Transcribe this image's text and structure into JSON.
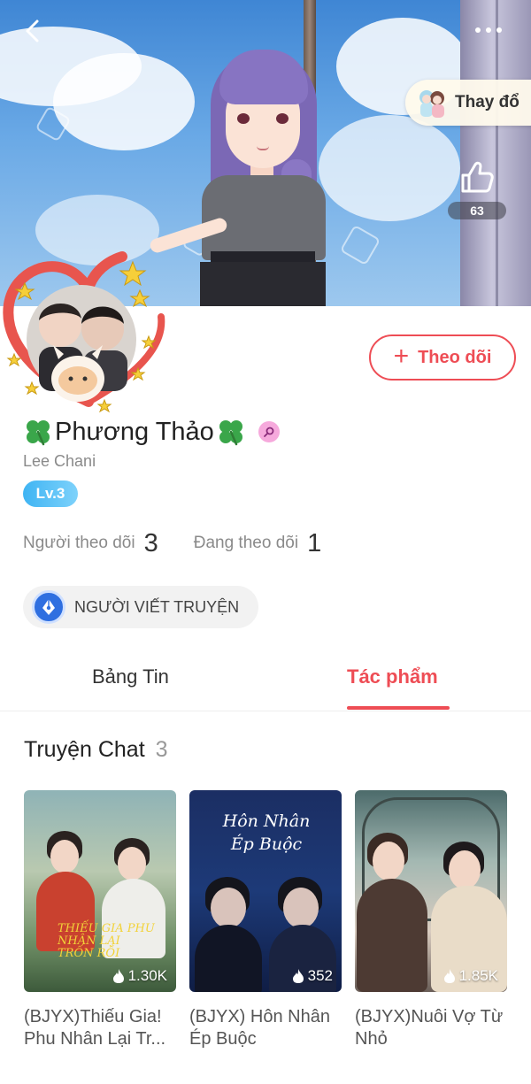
{
  "header": {
    "back_icon": "chevron-left-icon",
    "more_icon": "more-dots-icon",
    "change_label": "Thay đổ",
    "like_count": "63",
    "like_icon": "thumbs-up-icon"
  },
  "profile": {
    "follow_label": "Theo dõi",
    "follow_icon": "plus-icon",
    "name": "Phương Thảo",
    "name_decoration_icon": "four-leaf-clover-icon",
    "gender_icon": "female-icon",
    "username": "Lee Chani",
    "level": "Lv.3",
    "followers_label": "Người theo dõi",
    "followers_value": "3",
    "following_label": "Đang theo dõi",
    "following_value": "1",
    "writer_badge_label": "NGƯỜI VIẾT TRUYỆN",
    "writer_badge_icon": "pen-nib-icon"
  },
  "tabs": [
    {
      "label": "Bảng Tin",
      "active": false
    },
    {
      "label": "Tác phẩm",
      "active": true
    }
  ],
  "section": {
    "title": "Truyện Chat",
    "count": "3"
  },
  "stories": [
    {
      "title": "(BJYX)Thiếu Gia! Phu Nhân Lại Tr...",
      "views": "1.30K",
      "cover_text": "THIẾU GIA PHU NHÂN LẠI TRỐN RỒI"
    },
    {
      "title": "(BJYX) Hôn Nhân Ép Buộc",
      "views": "352",
      "cover_text": "Hôn Nhân Ép Buộc"
    },
    {
      "title": "(BJYX)Nuôi Vợ Từ Nhỏ",
      "views": "1.85K",
      "cover_text": ""
    }
  ],
  "colors": {
    "accent": "#ee4d55",
    "level_badge": "#3fb4f3",
    "writer_icon": "#2f6fe0"
  }
}
